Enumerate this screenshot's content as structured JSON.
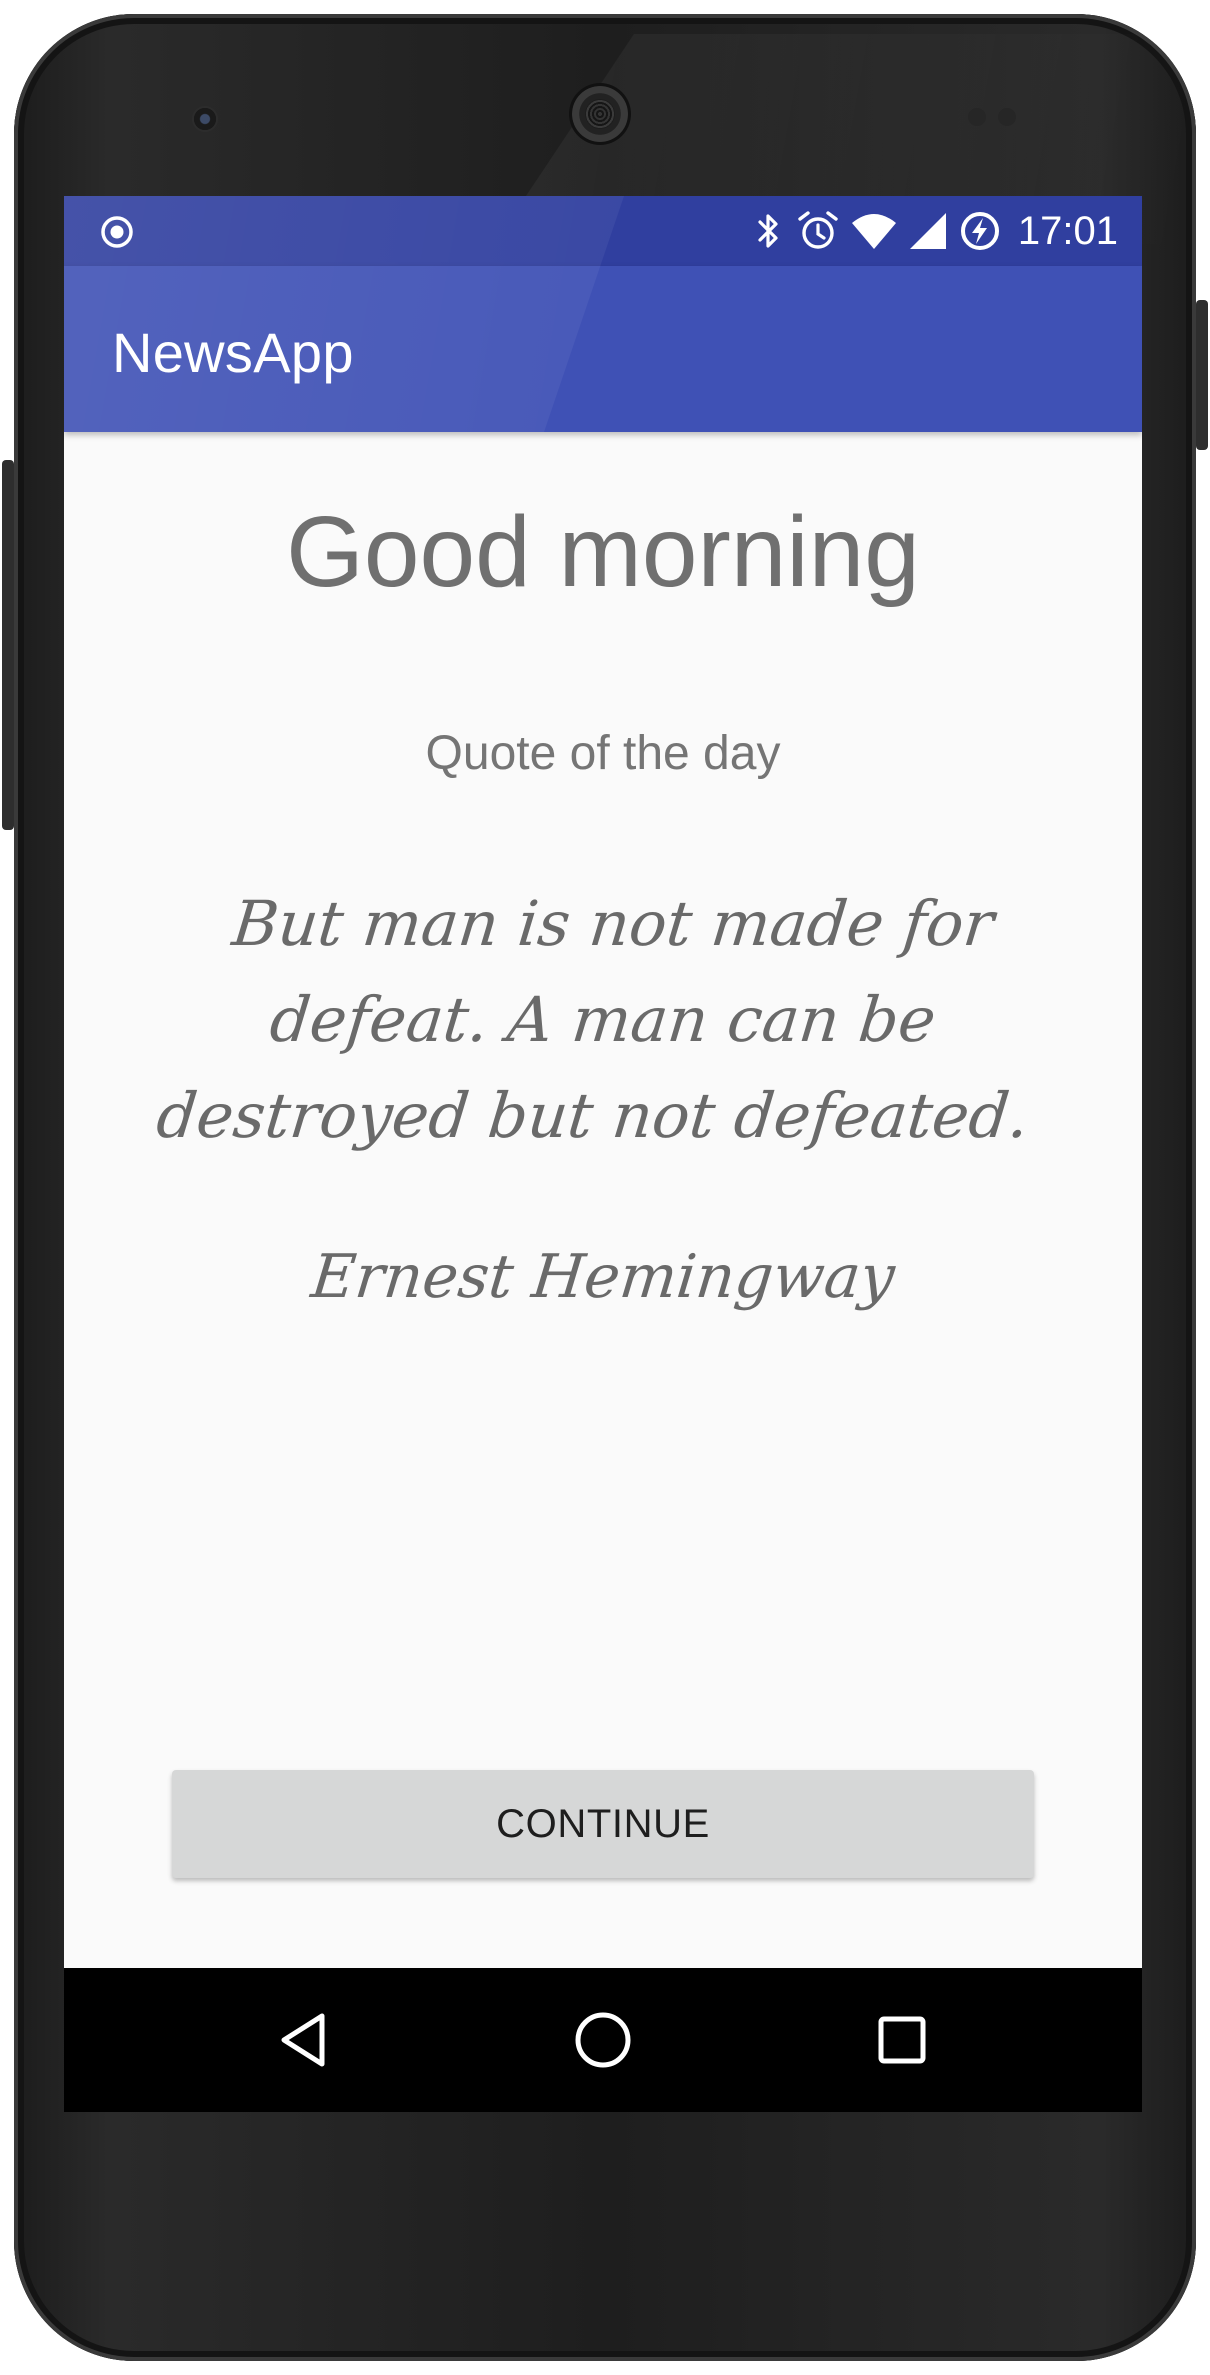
{
  "status_bar": {
    "time": "17:01",
    "left_icon": "record-circle-icon",
    "icons": [
      "bluetooth-icon",
      "alarm-clock-icon",
      "wifi-icon",
      "cell-signal-icon",
      "battery-charging-icon"
    ]
  },
  "app_bar": {
    "title": "NewsApp"
  },
  "main": {
    "greeting": "Good morning",
    "quote_heading": "Quote of the day",
    "quote_text": "But man is not made for defeat. A man can be destroyed but not defeated.",
    "quote_author": "Ernest Hemingway",
    "continue_label": "CONTINUE"
  },
  "navigation": {
    "buttons": [
      "back-icon",
      "home-icon",
      "recents-icon"
    ]
  },
  "colors": {
    "primary": "#3f51b5",
    "primary_dark": "#303f9f",
    "background": "#fafafa",
    "text_secondary": "#707070",
    "button_background": "#d6d7d7"
  }
}
